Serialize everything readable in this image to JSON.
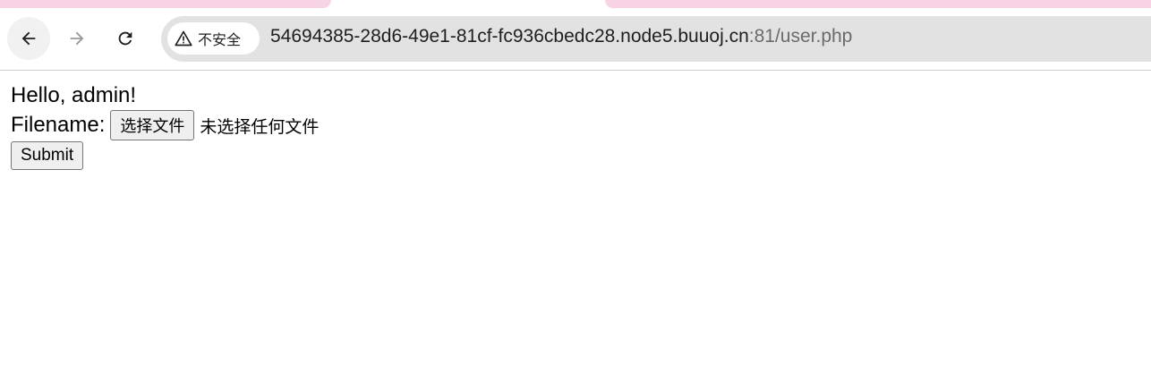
{
  "browser": {
    "security_label": "不安全",
    "url_host": "54694385-28d6-49e1-81cf-fc936cbedc28.node5.buuoj.cn",
    "url_path": ":81/user.php",
    "colors": {
      "tab_pink": "#f7d3e3",
      "omnibox_bg": "#e2e2e2"
    },
    "icons": [
      "back-arrow-icon",
      "forward-arrow-icon",
      "reload-icon",
      "warning-triangle-icon"
    ]
  },
  "page": {
    "greeting": "Hello, admin!",
    "file_label": "Filename:",
    "file_button_label": "选择文件",
    "file_status": "未选择任何文件",
    "submit_label": "Submit"
  }
}
